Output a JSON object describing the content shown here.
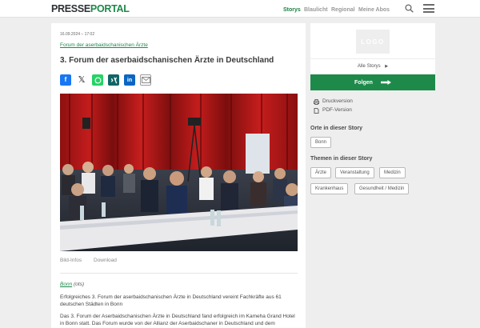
{
  "header": {
    "logo_part1": "PRESSE",
    "logo_part2": "PORTAL",
    "nav": [
      {
        "label": "Storys",
        "active": true
      },
      {
        "label": "Blaulicht",
        "active": false
      },
      {
        "label": "Regional",
        "active": false
      },
      {
        "label": "Meine Abos",
        "active": false
      }
    ],
    "search_icon": "search-icon",
    "menu_icon": "hamburger-menu-icon"
  },
  "article": {
    "date": "16.09.2024 – 17:02",
    "breadcrumb": "Forum der aserbaidschanischen Ärzte",
    "title": "3. Forum der aserbaidschanischen Ärzte in Deutschland",
    "share_icons": [
      "facebook-icon",
      "x-icon",
      "whatsapp-icon",
      "xing-icon",
      "linkedin-icon",
      "mail-icon"
    ],
    "image_links": [
      "Bild-Infos",
      "Download"
    ],
    "place": "Bonn",
    "source": "(ots)",
    "paragraphs": [
      "Erfolgreiches 3. Forum der aserbaidschanischen Ärzte in Deutschland vereint Fachkräfte aus 61 deutschen Städten in Bonn",
      "Das 3. Forum der Aserbaidschanischen Ärzte in Deutschland fand erfolgreich im Kameha Grand Hotel in Bonn statt. Das Forum wurde von der Allianz der Aserbaidschaner in Deutschland und dem"
    ]
  },
  "sidebar": {
    "logo_placeholder": "LOGO",
    "all_stories": "Alle Storys",
    "follow": "Folgen",
    "print": "Druckversion",
    "pdf": "PDF-Version",
    "places_heading": "Orte in dieser Story",
    "places": [
      "Bonn"
    ],
    "topics_heading": "Themen in dieser Story",
    "topics": [
      "Ärzte",
      "Veranstaltung",
      "Medizin",
      "Krankenhaus",
      "Gesundheit / Medizin"
    ]
  },
  "colors": {
    "brand_green": "#1d8a4a",
    "background": "#eeeeee"
  }
}
